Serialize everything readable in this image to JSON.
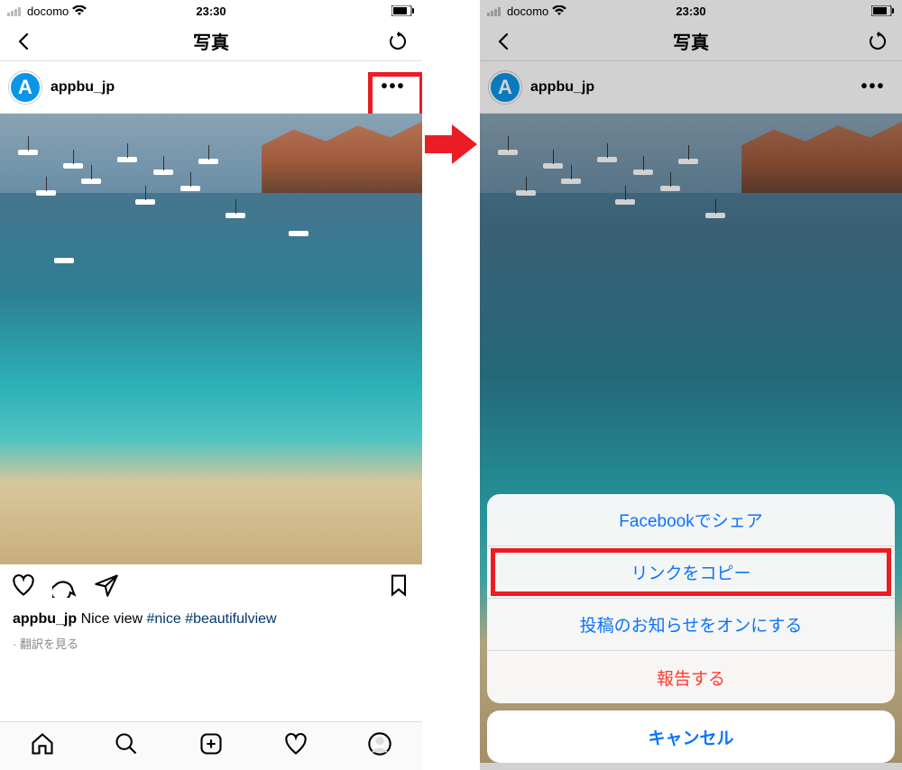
{
  "status": {
    "carrier": "docomo",
    "time": "23:30"
  },
  "nav": {
    "title": "写真"
  },
  "post": {
    "username": "appbu_jp",
    "avatar_letter": "A",
    "caption_user": "appbu_jp",
    "caption_text": "Nice view",
    "hashtag1": "#nice",
    "hashtag2": "#beautifulview",
    "translate": "翻訳を見る"
  },
  "sheet": {
    "items": [
      {
        "label": "Facebookでシェア",
        "destructive": false,
        "highlight": false
      },
      {
        "label": "リンクをコピー",
        "destructive": false,
        "highlight": true
      },
      {
        "label": "投稿のお知らせをオンにする",
        "destructive": false,
        "highlight": false
      },
      {
        "label": "報告する",
        "destructive": true,
        "highlight": false
      }
    ],
    "cancel": "キャンセル"
  }
}
